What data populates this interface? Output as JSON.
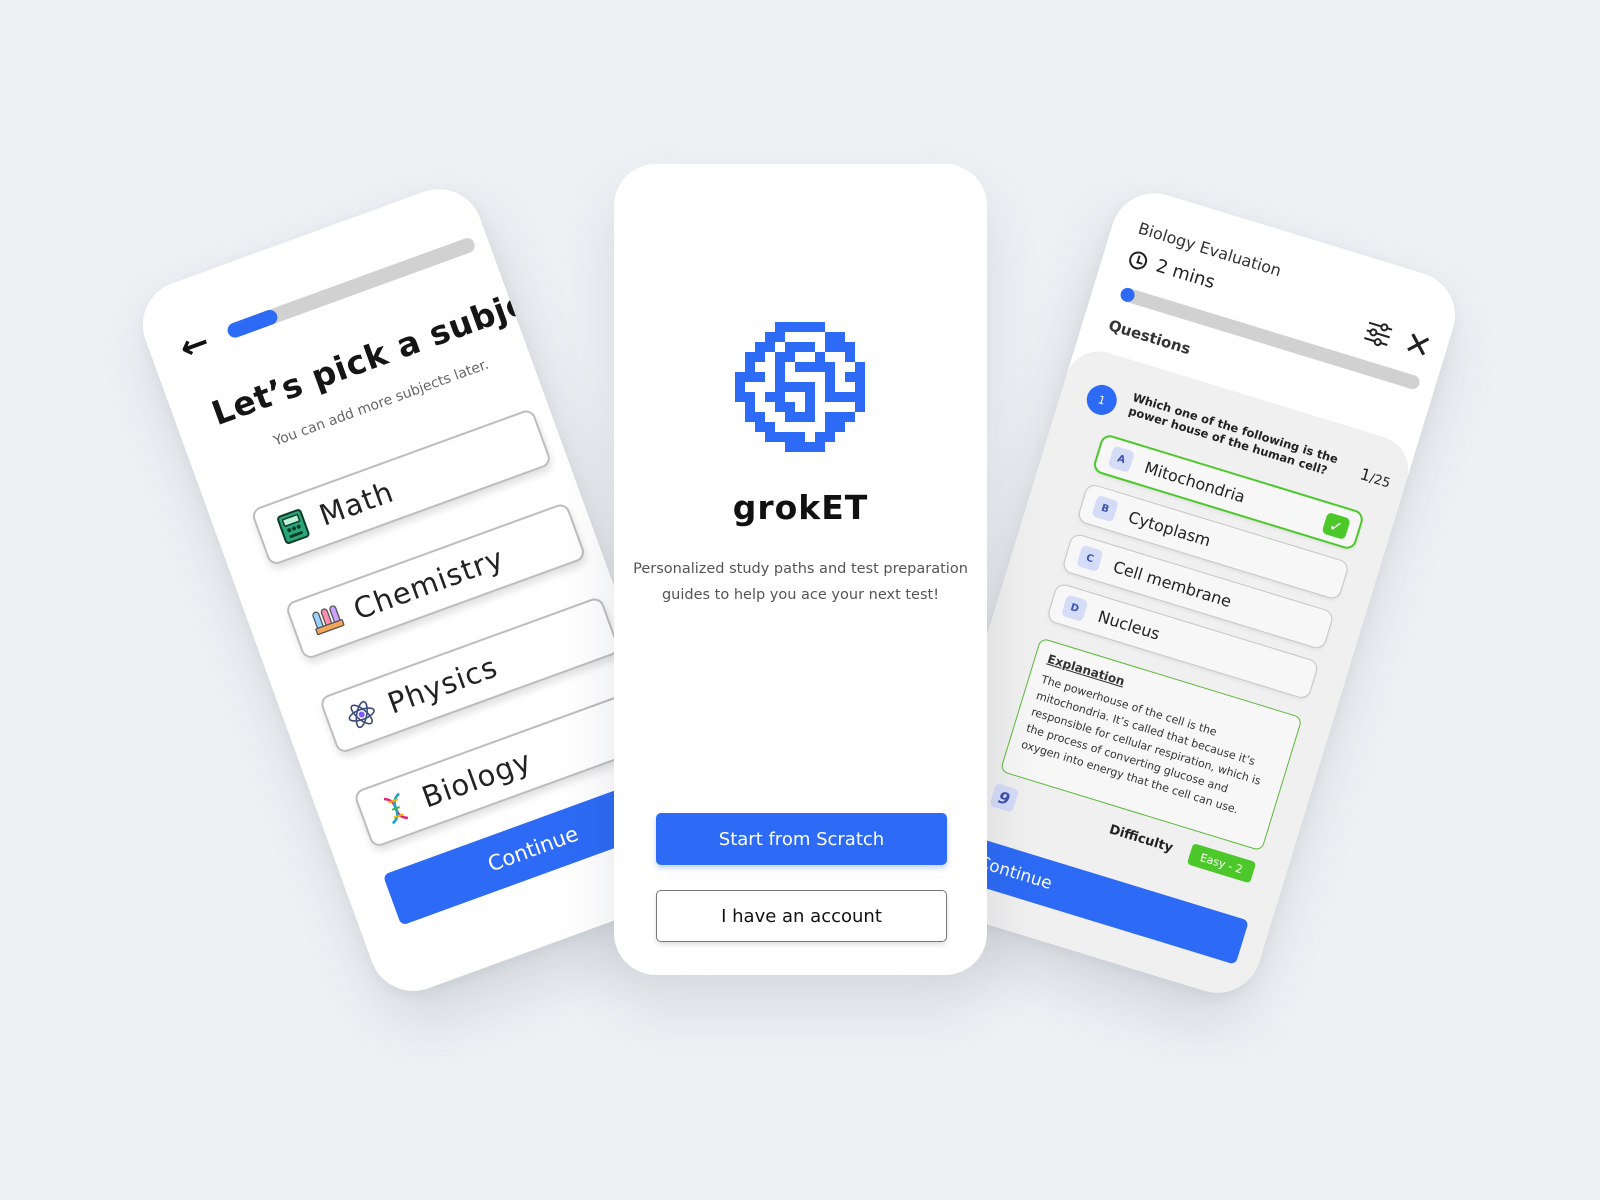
{
  "left": {
    "back_icon": "arrow-left-icon",
    "progress": 0.2,
    "title": "Let’s pick a subject",
    "subtitle": "You can add more subjects later.",
    "subjects": [
      {
        "label": "Math",
        "icon": "calculator-icon"
      },
      {
        "label": "Chemistry",
        "icon": "test-tubes-icon"
      },
      {
        "label": "Physics",
        "icon": "atom-icon"
      },
      {
        "label": "Biology",
        "icon": "dna-icon"
      }
    ],
    "continue_label": "Continue"
  },
  "center": {
    "logo_icon": "grid-maze-logo",
    "brand": "grokET",
    "tagline": "Personalized study paths and test preparation guides to help you ace your next test!",
    "start_label": "Start from Scratch",
    "account_label": "I have an account",
    "accent": "#2d6bf6"
  },
  "right": {
    "title": "Biology Evaluation",
    "timer": "2 mins",
    "progress": 0.04,
    "questions_label": "Questions",
    "question_number": "1",
    "question_text": "Which one of the following is the power house of the human cell?",
    "count_current": "1",
    "count_total": "/25",
    "options": [
      {
        "letter": "A",
        "text": "Mitochondria",
        "selected": true
      },
      {
        "letter": "B",
        "text": "Cytoplasm",
        "selected": false
      },
      {
        "letter": "C",
        "text": "Cell membrane",
        "selected": false
      },
      {
        "letter": "D",
        "text": "Nucleus",
        "selected": false
      }
    ],
    "explanation_title": "Explanation",
    "explanation_body": "The powerhouse of the cell is the mitochondria. It’s called that because it’s responsible for cellular respiration, which is the process of converting glucose and oxygen into energy that the cell can use.",
    "grade_value": "9",
    "difficulty_label": "Difficulty",
    "difficulty_badge": "Easy - 2",
    "continue_label": "Continue",
    "success_color": "#4cc82a"
  }
}
